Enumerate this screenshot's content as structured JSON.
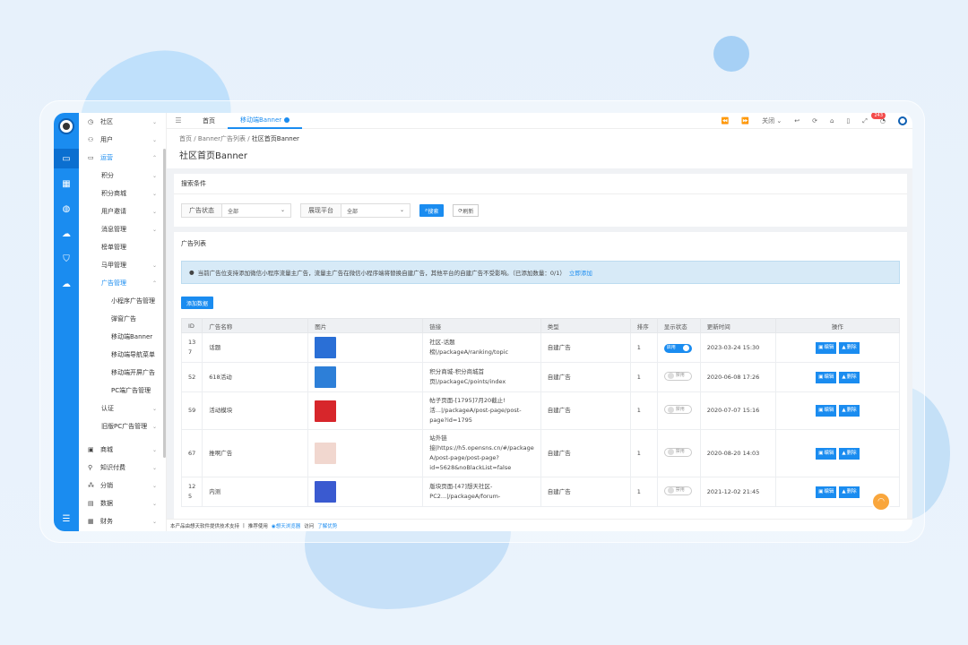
{
  "sidebar": {
    "items": [
      {
        "icon": "community-icon",
        "label": "社区",
        "arrow": "⌄"
      },
      {
        "icon": "user-icon",
        "label": "用户",
        "arrow": "⌄"
      },
      {
        "icon": "operation-icon",
        "label": "运营",
        "arrow": "⌃",
        "active": true
      },
      {
        "label": "积分",
        "arrow": "⌄"
      },
      {
        "label": "积分商城",
        "arrow": "⌄"
      },
      {
        "label": "用户邀请",
        "arrow": "⌄"
      },
      {
        "label": "消息管理",
        "arrow": "⌄"
      },
      {
        "label": "榜单管理",
        "arrow": ""
      },
      {
        "label": "马甲管理",
        "arrow": "⌄"
      },
      {
        "label": "广告管理",
        "arrow": "⌃",
        "active": true
      }
    ],
    "ad_sub": [
      "小程序广告管理",
      "弹窗广告",
      "移动端Banner",
      "移动端导航菜单",
      "移动端开屏广告",
      "PC端广告管理"
    ],
    "items2": [
      {
        "label": "认证",
        "arrow": "⌄"
      },
      {
        "label": "旧版PC广告管理",
        "arrow": "⌄"
      }
    ],
    "items3": [
      {
        "icon": "shop-icon",
        "label": "商城",
        "arrow": "⌄"
      },
      {
        "icon": "location-icon",
        "label": "知识付费",
        "arrow": "⌄"
      },
      {
        "icon": "distribution-icon",
        "label": "分销",
        "arrow": "⌄"
      },
      {
        "icon": "chart-icon",
        "label": "数据",
        "arrow": "⌄"
      },
      {
        "icon": "finance-icon",
        "label": "财务",
        "arrow": "⌄"
      }
    ]
  },
  "topbar": {
    "tabs": [
      {
        "label": "首页"
      },
      {
        "label": "移动端Banner",
        "active": true
      }
    ],
    "close_label": "关闭",
    "badge": "243"
  },
  "breadcrumb": [
    "首页",
    "Banner广告列表",
    "社区首页Banner"
  ],
  "page_title": "社区首页Banner",
  "search": {
    "title": "搜索条件",
    "field1_label": "广告状态",
    "field1_value": "全部",
    "field2_label": "展现平台",
    "field2_value": "全部",
    "search_btn": "搜索",
    "refresh_btn": "刷新"
  },
  "list": {
    "title": "广告列表",
    "notice": "当前广告位支持添加微信小程序流量主广告，流量主广告在微信小程序端将替换自建广告，其他平台的自建广告不受影响。（已添加数量：0/1）",
    "notice_link": "立即添加",
    "add_btn": "添加数据",
    "columns": [
      "ID",
      "广告名称",
      "图片",
      "链接",
      "类型",
      "排序",
      "显示状态",
      "更新时间",
      "操作"
    ],
    "rows": [
      {
        "id": "13\n7",
        "name": "话题",
        "img_color": "#2a6fd6",
        "link": "社区-话题\n榜|/packageA/ranking/topic",
        "type": "自建广告",
        "sort": "1",
        "status": "启用",
        "on": true,
        "time": "2023-03-24 15:30"
      },
      {
        "id": "52",
        "name": "618活动",
        "img_color": "#2d7fd8",
        "link": "积分商城-积分商城首\n页|/packageC/points/index",
        "type": "自建广告",
        "sort": "1",
        "status": "禁用",
        "on": false,
        "time": "2020-06-08 17:26"
      },
      {
        "id": "59",
        "name": "活动模块",
        "img_color": "#d7262b",
        "link": "帖子页面-[1795]7月20截止!\n活...|/packageA/post-page/post-\npage?id=1795",
        "type": "自建广告",
        "sort": "1",
        "status": "禁用",
        "on": false,
        "time": "2020-07-07 15:16"
      },
      {
        "id": "67",
        "name": "推啊广告",
        "img_color": "#f1d7cf",
        "link": "站外链\n接|https://h5.opensns.cn/#/package\nA/post-page/post-page?\nid=5628&noBlackList=false",
        "type": "自建广告",
        "sort": "1",
        "status": "禁用",
        "on": false,
        "time": "2020-08-20 14:03"
      },
      {
        "id": "12\n5",
        "name": "内测",
        "img_color": "#3a5ad0",
        "link": "版块页面-[47]想天社区-\nPC2...|/packageA/forum-",
        "type": "自建广告",
        "sort": "1",
        "status": "禁用",
        "on": false,
        "time": "2021-12-02 21:45"
      }
    ],
    "edit_label": "编辑",
    "delete_label": "删除"
  },
  "footer": {
    "text1": "本产品由想天软件提供技术支持",
    "sep": "|",
    "text2": "推荐使用",
    "browser": "想天浏览器",
    "text3": "访问",
    "link": "了解优势"
  }
}
